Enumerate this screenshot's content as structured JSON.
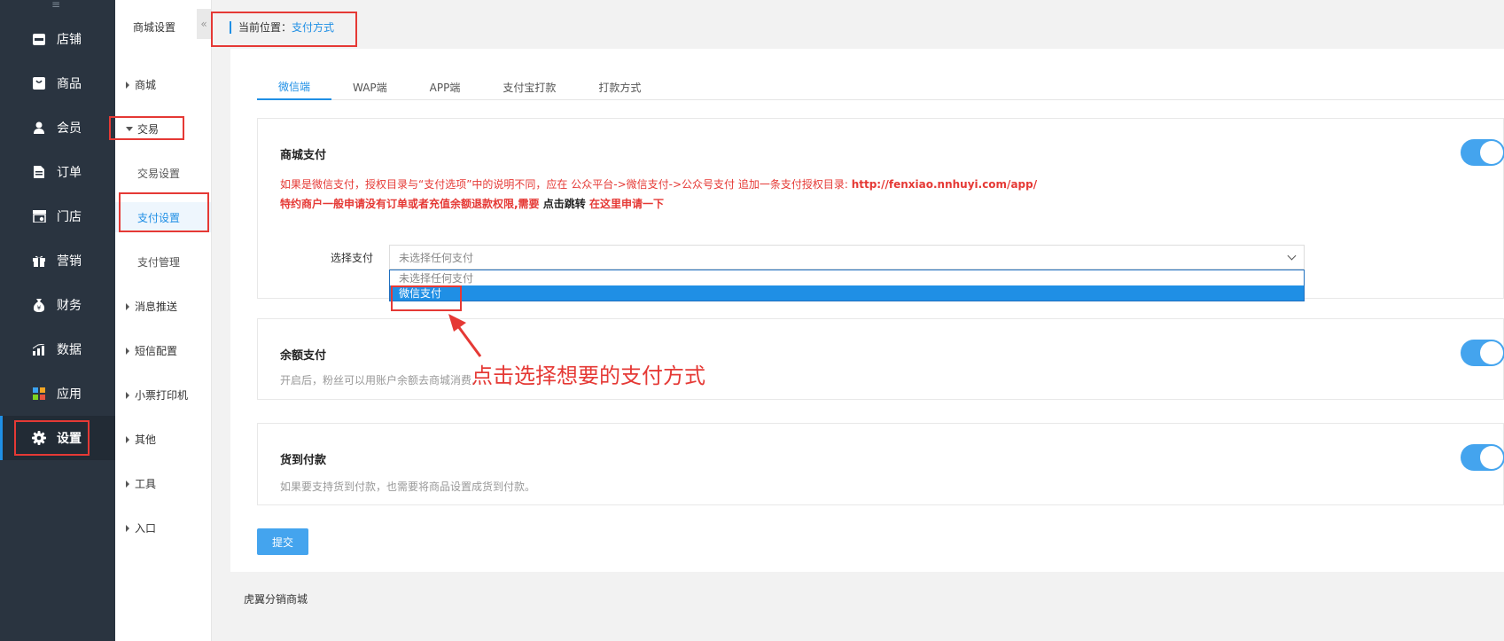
{
  "sidebar": {
    "items": [
      {
        "label": "店铺",
        "icon": "store-icon"
      },
      {
        "label": "商品",
        "icon": "product-icon"
      },
      {
        "label": "会员",
        "icon": "member-icon"
      },
      {
        "label": "订单",
        "icon": "order-icon"
      },
      {
        "label": "门店",
        "icon": "shop-icon"
      },
      {
        "label": "营销",
        "icon": "gift-icon"
      },
      {
        "label": "财务",
        "icon": "money-bag-icon"
      },
      {
        "label": "数据",
        "icon": "chart-icon"
      },
      {
        "label": "应用",
        "icon": "apps-icon"
      },
      {
        "label": "设置",
        "icon": "gear-icon"
      }
    ]
  },
  "subnav": {
    "title": "商城设置",
    "collapse": "«",
    "groups": [
      {
        "label": "商城"
      },
      {
        "label": "交易"
      },
      {
        "label": "消息推送"
      },
      {
        "label": "短信配置"
      },
      {
        "label": "小票打印机"
      },
      {
        "label": "其他"
      },
      {
        "label": "工具"
      },
      {
        "label": "入口"
      }
    ],
    "leaves": [
      {
        "label": "交易设置"
      },
      {
        "label": "支付设置"
      },
      {
        "label": "支付管理"
      }
    ]
  },
  "breadcrumb": {
    "prefix": "当前位置：",
    "current": "支付方式"
  },
  "tabs": [
    "微信端",
    "WAP端",
    "APP端",
    "支付宝打款",
    "打款方式"
  ],
  "cards": {
    "wechat": {
      "title": "商城支付",
      "warn1_text": "如果是微信支付，授权目录与“支付选项”中的说明不同，应在 公众平台->微信支付->公众号支付 追加一条支付授权目录: ",
      "warn1_url": "http://fenxiao.nnhuyi.com/app/",
      "warn2_text": "特约商户一般申请没有订单或者充值余额退款权限,需要 ",
      "warn2_link": "点击跳转",
      "warn2_tail": " 在这里申请一下",
      "select_label": "选择支付",
      "select_value": "未选择任何支付",
      "options": [
        "未选择任何支付",
        "微信支付"
      ],
      "enabled": true
    },
    "balance": {
      "title": "余额支付",
      "desc": "开启后，粉丝可以用账户余额去商城消费.",
      "enabled": true
    },
    "cod": {
      "title": "货到付款",
      "desc": "如果要支持货到付款，也需要将商品设置成货到付款。",
      "enabled": true
    }
  },
  "submit_label": "提交",
  "footer": "虎翼分销商城",
  "annotation": "点击选择想要的支付方式",
  "colors": {
    "accent": "#1f8fe5",
    "sidebar": "#2a3440",
    "annotation": "#e53935"
  }
}
